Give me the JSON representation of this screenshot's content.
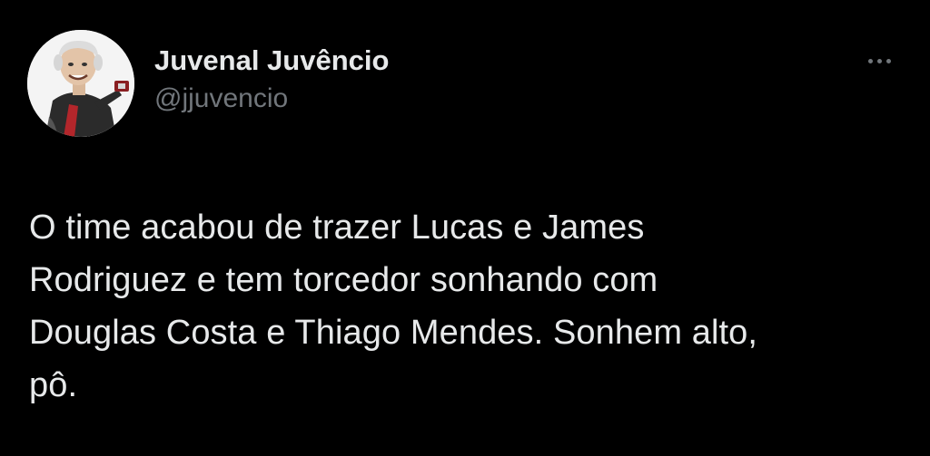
{
  "theme": {
    "background": "#000000",
    "primary_text": "#e7e9ea",
    "secondary_text": "#71767b"
  },
  "author": {
    "display_name": "Juvenal Juvêncio",
    "handle": "@jjuvencio",
    "avatar_icon": "caricature-avatar"
  },
  "actions": {
    "more_icon": "more-horizontal-icon"
  },
  "tweet": {
    "text_lines": [
      "O time acabou de trazer Lucas e James",
      "Rodriguez e tem torcedor sonhando com",
      "Douglas Costa e  Thiago Mendes. Sonhem alto,",
      "pô."
    ]
  }
}
